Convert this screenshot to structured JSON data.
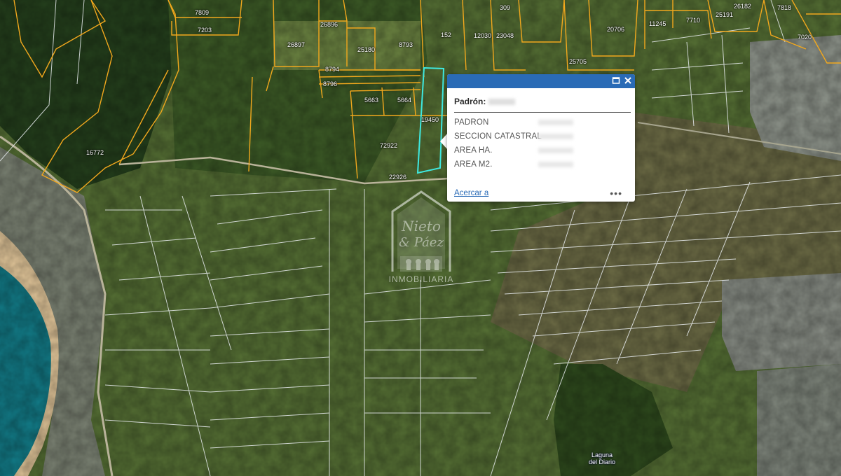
{
  "map": {
    "colors": {
      "parcel_orange": "#f2a81d",
      "parcel_white": "#e8ecef",
      "highlight": "#3ee8e0",
      "forest": "#243f1c",
      "field": "#5d7a3a",
      "wetland": "#6f7048",
      "ocean": "#127a86",
      "beach": "#e3c79a",
      "urban": "#8a8f8a"
    },
    "parcel_labels": [
      "7809",
      "7203",
      "26896",
      "26897",
      "25180",
      "8793",
      "152",
      "12030",
      "23048",
      "309",
      "25705",
      "20706",
      "11245",
      "7710",
      "25191",
      "26182",
      "7818",
      "7020",
      "8794",
      "8796",
      "5663",
      "5664",
      "19450",
      "72922",
      "22926",
      "16772"
    ],
    "place_label": [
      "Laguna",
      "del Diario"
    ]
  },
  "popup": {
    "title": "Padrón:",
    "fields": [
      {
        "label": "PADRON"
      },
      {
        "label": "SECCION CATASTRAL"
      },
      {
        "label": "AREA HA."
      },
      {
        "label": "AREA M2."
      }
    ],
    "zoom_link": "Acercar a",
    "more_icon": "ellipsis-icon",
    "maximize_icon": "maximize-icon",
    "close_icon": "close-icon"
  },
  "watermark": {
    "text": "INMOBILIARIA"
  }
}
